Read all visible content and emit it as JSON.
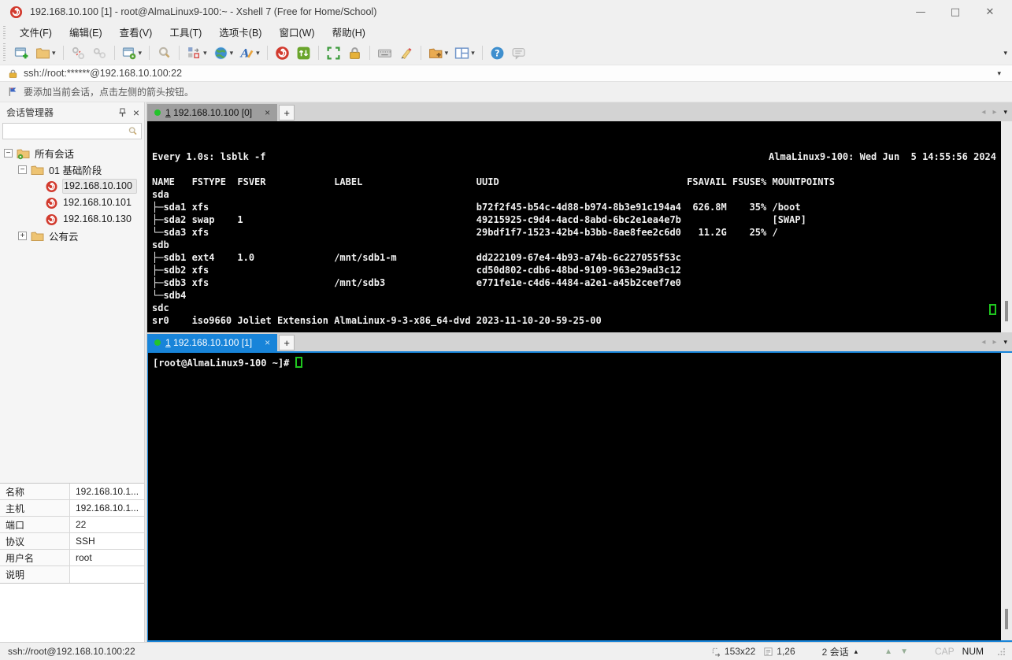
{
  "colors": {
    "accent_blue": "#1884d9",
    "terminal_green": "#1fc71f",
    "tab_dot_green": "#23c32b",
    "xshell_red": "#d23b2f"
  },
  "window": {
    "title": "192.168.10.100 [1] - root@AlmaLinux9-100:~ - Xshell 7 (Free for Home/School)",
    "minimize": "—",
    "maximize": "□",
    "close": "✕"
  },
  "menu": {
    "items": [
      {
        "name": "menu-item-file",
        "label": "文件(F)"
      },
      {
        "name": "menu-item-edit",
        "label": "编辑(E)"
      },
      {
        "name": "menu-item-view",
        "label": "查看(V)"
      },
      {
        "name": "menu-item-tools",
        "label": "工具(T)"
      },
      {
        "name": "menu-item-tabs",
        "label": "选项卡(B)"
      },
      {
        "name": "menu-item-window",
        "label": "窗口(W)"
      },
      {
        "name": "menu-item-help",
        "label": "帮助(H)"
      }
    ]
  },
  "toolbar": {
    "buttons": [
      {
        "name": "new-session-icon"
      },
      {
        "name": "open-folder-icon",
        "caret": true
      },
      {
        "sep": true
      },
      {
        "name": "disconnect-icon"
      },
      {
        "name": "reconnect-icon"
      },
      {
        "sep": true
      },
      {
        "name": "session-properties-icon",
        "caret": true
      },
      {
        "sep": true
      },
      {
        "name": "find-icon"
      },
      {
        "sep": true
      },
      {
        "name": "arrange-icon",
        "caret": true
      },
      {
        "name": "encoding-globe-icon",
        "caret": true
      },
      {
        "name": "font-icon",
        "caret": true
      },
      {
        "sep": true
      },
      {
        "name": "xshell-icon"
      },
      {
        "name": "xftp-icon"
      },
      {
        "sep": true
      },
      {
        "name": "fullscreen-icon"
      },
      {
        "name": "lock-screen-icon"
      },
      {
        "sep": true
      },
      {
        "name": "virtual-keyboard-icon"
      },
      {
        "name": "highlighter-icon"
      },
      {
        "sep": true
      },
      {
        "name": "new-file-icon",
        "caret": true
      },
      {
        "name": "split-layout-icon",
        "caret": true
      },
      {
        "sep": true
      },
      {
        "name": "help-icon"
      },
      {
        "name": "feedback-icon"
      }
    ]
  },
  "address_bar": {
    "url": "ssh://root:******@192.168.10.100:22"
  },
  "info_bar": {
    "message": "要添加当前会话，点击左侧的箭头按钮。"
  },
  "session_manager": {
    "title": "会话管理器",
    "tree": [
      {
        "indent": 0,
        "toggle": "minus",
        "icon": "folder-root",
        "label": "所有会话"
      },
      {
        "indent": 1,
        "toggle": "minus",
        "icon": "folder",
        "label": "01 基础阶段"
      },
      {
        "indent": 2,
        "toggle": "none",
        "icon": "session",
        "label": "192.168.10.100",
        "selected": true
      },
      {
        "indent": 2,
        "toggle": "none",
        "icon": "session",
        "label": "192.168.10.101"
      },
      {
        "indent": 2,
        "toggle": "none",
        "icon": "session",
        "label": "192.168.10.130"
      },
      {
        "indent": 1,
        "toggle": "plus",
        "icon": "folder",
        "label": "公有云"
      }
    ],
    "properties": [
      {
        "label": "名称",
        "value": "192.168.10.1..."
      },
      {
        "label": "主机",
        "value": "192.168.10.1..."
      },
      {
        "label": "端口",
        "value": "22"
      },
      {
        "label": "协议",
        "value": "SSH"
      },
      {
        "label": "用户名",
        "value": "root"
      },
      {
        "label": "说明",
        "value": ""
      }
    ]
  },
  "tabs": {
    "pane1": {
      "number": "1",
      "label": "192.168.10.100 [0]"
    },
    "pane2": {
      "number": "1",
      "label": "192.168.10.100 [1]"
    }
  },
  "terminal1": {
    "header_left": "Every 1.0s: lsblk -f",
    "header_right": "AlmaLinux9-100: Wed Jun  5 14:55:56 2024",
    "body": "\nNAME   FSTYPE  FSVER            LABEL                    UUID                                 FSAVAIL FSUSE% MOUNTPOINTS\nsda\n├─sda1 xfs                                               b72f2f45-b54c-4d88-b974-8b3e91c194a4  626.8M    35% /boot\n├─sda2 swap    1                                         49215925-c9d4-4acd-8abd-6bc2e1ea4e7b                [SWAP]\n└─sda3 xfs                                               29bdf1f7-1523-42b4-b3bb-8ae8fee2c6d0   11.2G    25% /\nsdb\n├─sdb1 ext4    1.0              /mnt/sdb1-m              dd222109-67e4-4b93-a74b-6c227055f53c\n├─sdb2 xfs                                               cd50d802-cdb6-48bd-9109-963e29ad3c12\n├─sdb3 xfs                      /mnt/sdb3                e771fe1e-c4d6-4484-a2e1-a45b2ceef7e0\n└─sdb4\nsdc\nsr0    iso9660 Joliet Extension AlmaLinux-9-3-x86_64-dvd 2023-11-10-20-59-25-00"
  },
  "terminal2": {
    "prompt": "[root@AlmaLinux9-100 ~]# "
  },
  "status_bar": {
    "address": "ssh://root@192.168.10.100:22",
    "terminal_size": "153x22",
    "cursor_position": "1,26",
    "sessions": "2 会话",
    "cap": "CAP",
    "num": "NUM"
  },
  "glyphs": {
    "caret_down": "▾",
    "caret_up": "▴",
    "tab_prev": "◂",
    "tab_next": "▸",
    "plus": "+",
    "close": "×",
    "arrow_up": "▲",
    "arrow_down": "▼"
  }
}
